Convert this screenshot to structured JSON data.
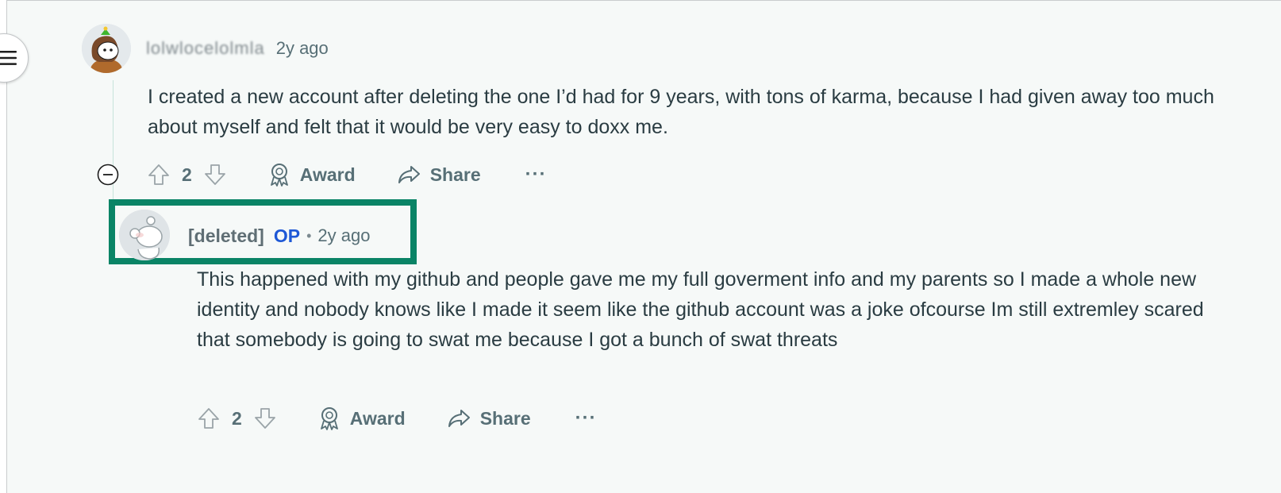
{
  "comment1": {
    "username": "lolwlocelolmla",
    "time": "2y ago",
    "body": "I created a new account after deleting the one I’d had for 9 years, with tons of karma, because I had given away too much about myself and felt that it would be very easy to doxx me.",
    "score": "2",
    "award_label": "Award",
    "share_label": "Share",
    "more_label": "···"
  },
  "comment2": {
    "username": "[deleted]",
    "op_badge": "OP",
    "separator": "•",
    "time": "2y ago",
    "body": "This happened with my github and people gave me my full goverment info and my parents so I made a whole new identity and nobody knows like I made it seem like the github account was a joke ofcourse Im still extremley scared that somebody is going to swat me because I got a bunch of swat threats",
    "score": "2",
    "award_label": "Award",
    "share_label": "Share",
    "more_label": "···"
  },
  "colors": {
    "highlight": "#0a8466",
    "op": "#1e58d6",
    "muted": "#576f76"
  }
}
